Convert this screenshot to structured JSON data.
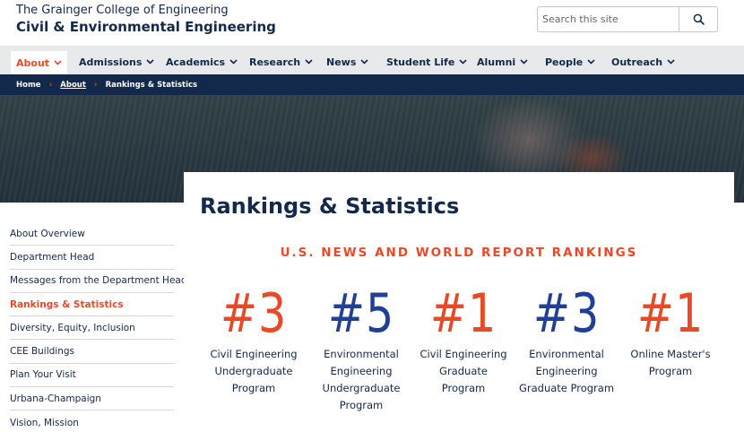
{
  "header": {
    "college": "The Grainger College of Engineering",
    "department": "Civil & Environmental Engineering",
    "search_placeholder": "Search this site",
    "search_icon": "search-icon"
  },
  "nav": {
    "items": [
      {
        "label": "About",
        "active": true
      },
      {
        "label": "Admissions"
      },
      {
        "label": "Academics"
      },
      {
        "label": "Research"
      },
      {
        "label": "News"
      },
      {
        "label": "Student Life"
      },
      {
        "label": "Alumni"
      },
      {
        "label": "People"
      },
      {
        "label": "Outreach"
      }
    ]
  },
  "breadcrumb": {
    "home": "Home",
    "about": "About",
    "current": "Rankings & Statistics"
  },
  "sidebar": {
    "items": [
      {
        "label": "About Overview"
      },
      {
        "label": "Department Head"
      },
      {
        "label": "Messages from the Department Head"
      },
      {
        "label": "Rankings & Statistics",
        "active": true
      },
      {
        "label": "Diversity, Equity, Inclusion"
      },
      {
        "label": "CEE Buildings"
      },
      {
        "label": "Plan Your Visit"
      },
      {
        "label": "Urbana-Champaign"
      },
      {
        "label": "Vision, Mission"
      }
    ]
  },
  "main": {
    "title": "Rankings & Statistics",
    "rankings_heading": "U.S. NEWS AND WORLD REPORT RANKINGS",
    "rankings": [
      {
        "number": "#3",
        "label_lines": [
          "Civil Engineering",
          "Undergraduate",
          "Program"
        ],
        "color": "#e84a27"
      },
      {
        "number": "#5",
        "label_lines": [
          "Environmental",
          "Engineering",
          "Undergraduate",
          "Program"
        ],
        "color": "#1f4096"
      },
      {
        "number": "#1",
        "label_lines": [
          "Civil Engineering",
          "Graduate",
          "Program"
        ],
        "color": "#e84a27"
      },
      {
        "number": "#3",
        "label_lines": [
          "Environmental",
          "Engineering",
          "Graduate Program"
        ],
        "color": "#1f4096"
      },
      {
        "number": "#1",
        "label_lines": [
          "Online Master's",
          "Program"
        ],
        "color": "#e84a27"
      }
    ]
  },
  "colors": {
    "navy": "#13294b",
    "orange": "#e84a27",
    "blue": "#1f4096",
    "nav_bg": "#e8e9eb"
  }
}
